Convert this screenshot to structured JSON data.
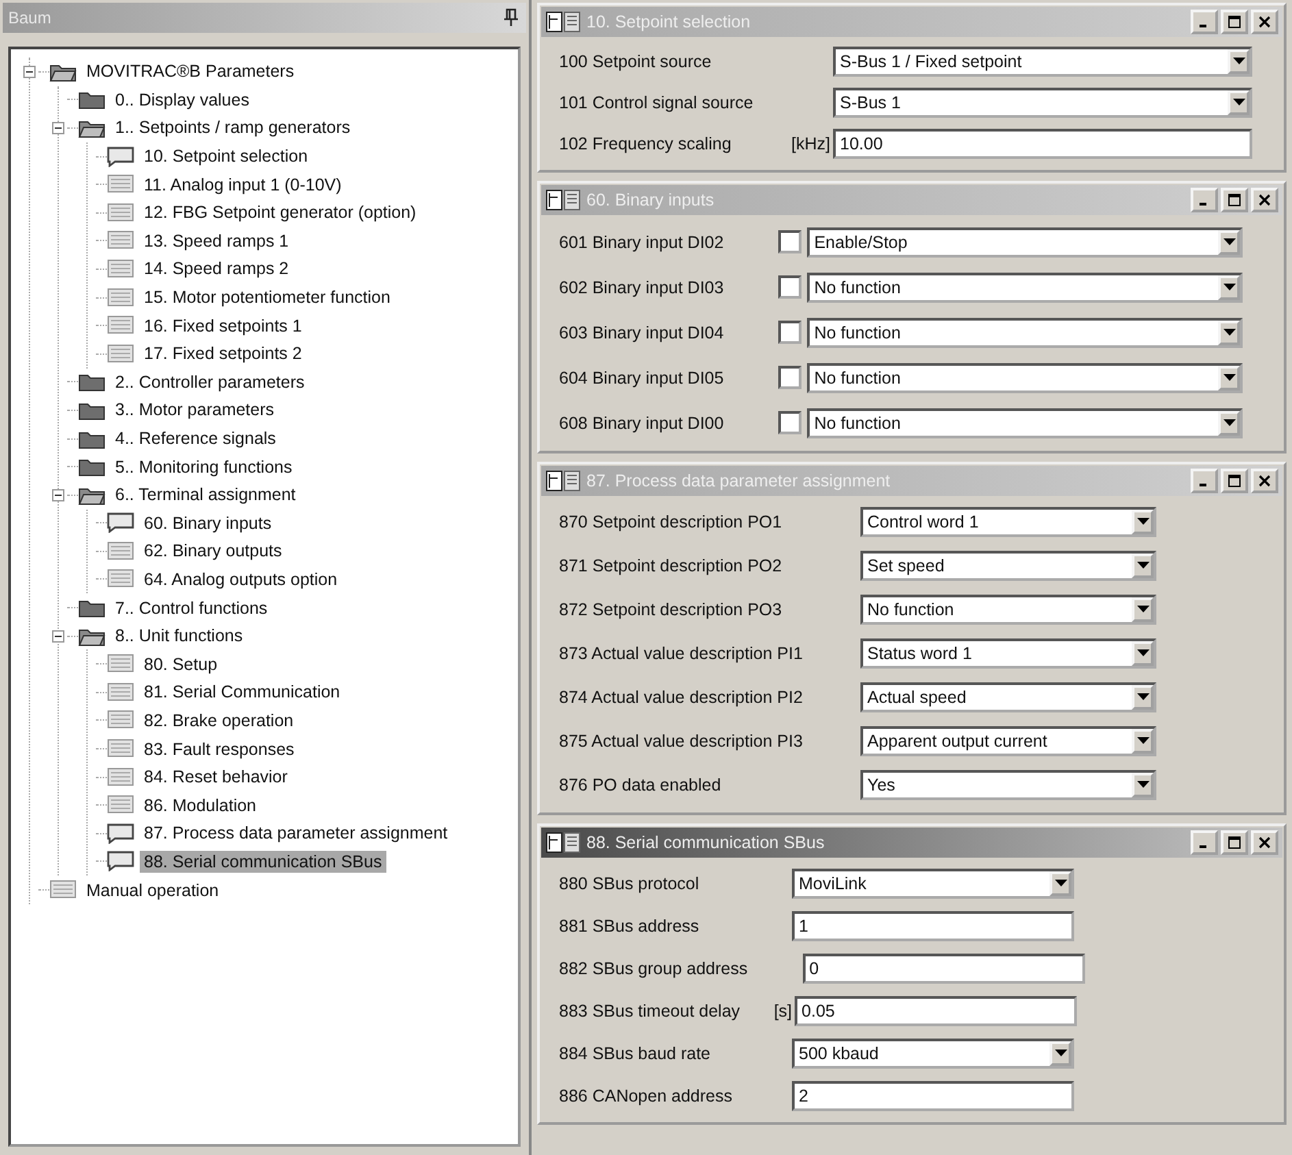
{
  "tree_panel": {
    "title": "Baum",
    "items": [
      {
        "label": "MOVITRAC®B Parameters",
        "kind": "folder",
        "expanded": true,
        "selected": false,
        "children": [
          {
            "label": "0.. Display values",
            "kind": "folder",
            "expanded": false,
            "selected": false
          },
          {
            "label": "1.. Setpoints / ramp generators",
            "kind": "folder",
            "expanded": true,
            "selected": false,
            "children": [
              {
                "label": "10. Setpoint selection",
                "kind": "note",
                "selected": false
              },
              {
                "label": "11. Analog input 1 (0-10V)",
                "kind": "sheet",
                "selected": false
              },
              {
                "label": "12. FBG Setpoint generator (option)",
                "kind": "sheet",
                "selected": false
              },
              {
                "label": "13. Speed ramps 1",
                "kind": "sheet",
                "selected": false
              },
              {
                "label": "14. Speed ramps 2",
                "kind": "sheet",
                "selected": false
              },
              {
                "label": "15. Motor potentiometer function",
                "kind": "sheet",
                "selected": false
              },
              {
                "label": "16. Fixed setpoints 1",
                "kind": "sheet",
                "selected": false
              },
              {
                "label": "17. Fixed setpoints 2",
                "kind": "sheet",
                "selected": false
              }
            ]
          },
          {
            "label": "2.. Controller parameters",
            "kind": "folder",
            "expanded": false,
            "selected": false
          },
          {
            "label": "3.. Motor parameters",
            "kind": "folder",
            "expanded": false,
            "selected": false
          },
          {
            "label": "4.. Reference signals",
            "kind": "folder",
            "expanded": false,
            "selected": false
          },
          {
            "label": "5.. Monitoring functions",
            "kind": "folder",
            "expanded": false,
            "selected": false
          },
          {
            "label": "6.. Terminal assignment",
            "kind": "folder",
            "expanded": true,
            "selected": false,
            "children": [
              {
                "label": "60. Binary inputs",
                "kind": "note",
                "selected": false
              },
              {
                "label": "62. Binary outputs",
                "kind": "sheet",
                "selected": false
              },
              {
                "label": "64. Analog outputs option",
                "kind": "sheet",
                "selected": false
              }
            ]
          },
          {
            "label": "7.. Control functions",
            "kind": "folder",
            "expanded": false,
            "selected": false
          },
          {
            "label": "8.. Unit functions",
            "kind": "folder",
            "expanded": true,
            "selected": false,
            "children": [
              {
                "label": "80. Setup",
                "kind": "sheet",
                "selected": false
              },
              {
                "label": "81. Serial Communication",
                "kind": "sheet",
                "selected": false
              },
              {
                "label": "82. Brake operation",
                "kind": "sheet",
                "selected": false
              },
              {
                "label": "83. Fault responses",
                "kind": "sheet",
                "selected": false
              },
              {
                "label": "84. Reset behavior",
                "kind": "sheet",
                "selected": false
              },
              {
                "label": "86. Modulation",
                "kind": "sheet",
                "selected": false
              },
              {
                "label": "87. Process data parameter assignment",
                "kind": "note",
                "selected": false
              },
              {
                "label": "88. Serial communication SBus",
                "kind": "note",
                "selected": true
              }
            ]
          }
        ]
      },
      {
        "label": "Manual operation",
        "kind": "sheet",
        "selected": false
      }
    ]
  },
  "windows": [
    {
      "title": "10. Setpoint selection",
      "active": false,
      "fields": [
        {
          "label": "100 Setpoint source",
          "kind": "select",
          "value": "S-Bus 1 / Fixed setpoint"
        },
        {
          "label": "101 Control signal source",
          "kind": "select",
          "value": "S-Bus 1"
        },
        {
          "label": "102 Frequency scaling",
          "unit": "[kHz]",
          "kind": "text",
          "value": "10.00"
        }
      ]
    },
    {
      "title": "60. Binary inputs",
      "active": false,
      "fields": [
        {
          "label": "601 Binary input DI02",
          "checked": false,
          "kind": "select",
          "value": "Enable/Stop"
        },
        {
          "label": "602 Binary input DI03",
          "checked": false,
          "kind": "select",
          "value": "No function"
        },
        {
          "label": "603 Binary input DI04",
          "checked": false,
          "kind": "select",
          "value": "No function"
        },
        {
          "label": "604 Binary input DI05",
          "checked": false,
          "kind": "select",
          "value": "No function"
        },
        {
          "label": "608 Binary input DI00",
          "checked": false,
          "kind": "select",
          "value": "No function"
        }
      ]
    },
    {
      "title": "87. Process data parameter assignment",
      "active": false,
      "fields": [
        {
          "label": "870 Setpoint description PO1",
          "kind": "select",
          "value": "Control word 1"
        },
        {
          "label": "871 Setpoint description PO2",
          "kind": "select",
          "value": "Set speed"
        },
        {
          "label": "872 Setpoint description PO3",
          "kind": "select",
          "value": "No function"
        },
        {
          "label": "873 Actual value description PI1",
          "kind": "select",
          "value": "Status word 1"
        },
        {
          "label": "874 Actual value description PI2",
          "kind": "select",
          "value": "Actual speed"
        },
        {
          "label": "875 Actual value description PI3",
          "kind": "select",
          "value": "Apparent output current"
        },
        {
          "label": "876 PO data enabled",
          "kind": "select",
          "value": "Yes"
        }
      ]
    },
    {
      "title": "88. Serial communication SBus",
      "active": true,
      "fields": [
        {
          "label": "880 SBus protocol",
          "kind": "select",
          "value": "MoviLink"
        },
        {
          "label": "881 SBus address",
          "kind": "text",
          "value": "1"
        },
        {
          "label": "882 SBus group address",
          "kind": "text",
          "value": "0"
        },
        {
          "label": "883 SBus timeout delay",
          "unit": "[s]",
          "kind": "text",
          "value": "0.05"
        },
        {
          "label": "884 SBus baud rate",
          "kind": "select",
          "value": "500 kbaud"
        },
        {
          "label": "886 CANopen address",
          "kind": "text",
          "value": "2"
        }
      ]
    }
  ]
}
